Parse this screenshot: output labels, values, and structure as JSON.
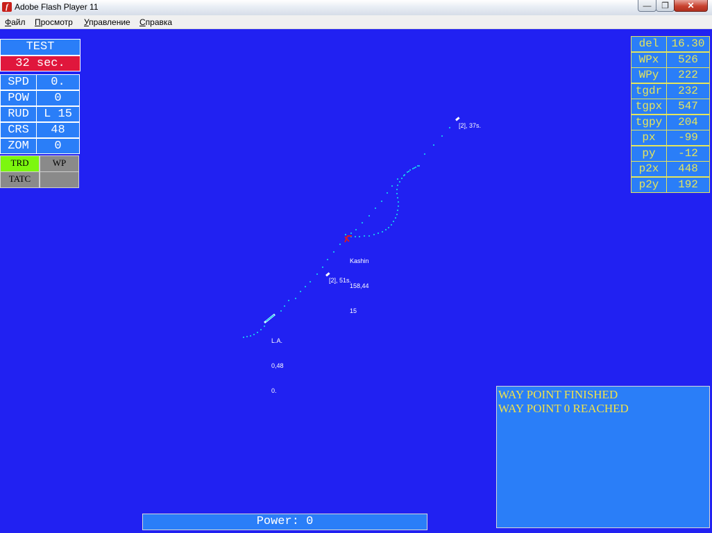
{
  "window": {
    "title": "Adobe Flash Player 11",
    "app_icon": "f",
    "buttons": {
      "minimize": "—",
      "maximize": "❐",
      "close": "✕"
    }
  },
  "menu": [
    "Файл",
    "Просмотр",
    "Управление",
    "Справка"
  ],
  "left_panel": {
    "mode": "TEST",
    "timer": "32 sec.",
    "stats": [
      {
        "label": "SPD",
        "value": "0."
      },
      {
        "label": "POW",
        "value": "0"
      },
      {
        "label": "RUD",
        "value": "L 15"
      },
      {
        "label": "CRS",
        "value": "48"
      },
      {
        "label": "ZOM",
        "value": "0"
      }
    ],
    "buttons": [
      {
        "label": "TRD",
        "state": "active",
        "color": "#7cf70f"
      },
      {
        "label": "WP",
        "state": "inactive",
        "color": "#8a8a8a"
      },
      {
        "label": "TATC",
        "state": "inactive",
        "color": "#8a8a8a"
      },
      {
        "label": "",
        "state": "inactive",
        "color": "#8a8a8a"
      }
    ],
    "timer_color": "#e0163c"
  },
  "right_panel": {
    "rows": [
      {
        "label": "del",
        "value": "16.30"
      },
      {
        "label": "WPx",
        "value": "526"
      },
      {
        "label": "WPy",
        "value": "222"
      },
      {
        "label": "tgdr",
        "value": "232"
      },
      {
        "label": "tgpx",
        "value": "547"
      },
      {
        "label": "tgpy",
        "value": "204"
      },
      {
        "label": "px",
        "value": "-99"
      },
      {
        "label": "py",
        "value": "-12"
      },
      {
        "label": "p2x",
        "value": "448"
      },
      {
        "label": "p2y",
        "value": "192"
      }
    ]
  },
  "map": {
    "waypoint_top_label": "[2], 37s.",
    "waypoint_mid_label": "[2], 51s.",
    "target": {
      "name": "Kashin",
      "line2": "158,44",
      "line3": "15"
    },
    "own_ship": {
      "name": "L.A.",
      "line2": "0,48",
      "line3": "0."
    }
  },
  "log": [
    "WAY POINT FINISHED",
    "WAY POINT 0 REACHED"
  ],
  "power": "Power: 0",
  "colors": {
    "background": "#2121f2",
    "panel": "#2a7ef8",
    "panel_text": "#ffffff",
    "readout_text": "#e5e55c",
    "track": "#18c8f0",
    "target": "#d81a24"
  }
}
